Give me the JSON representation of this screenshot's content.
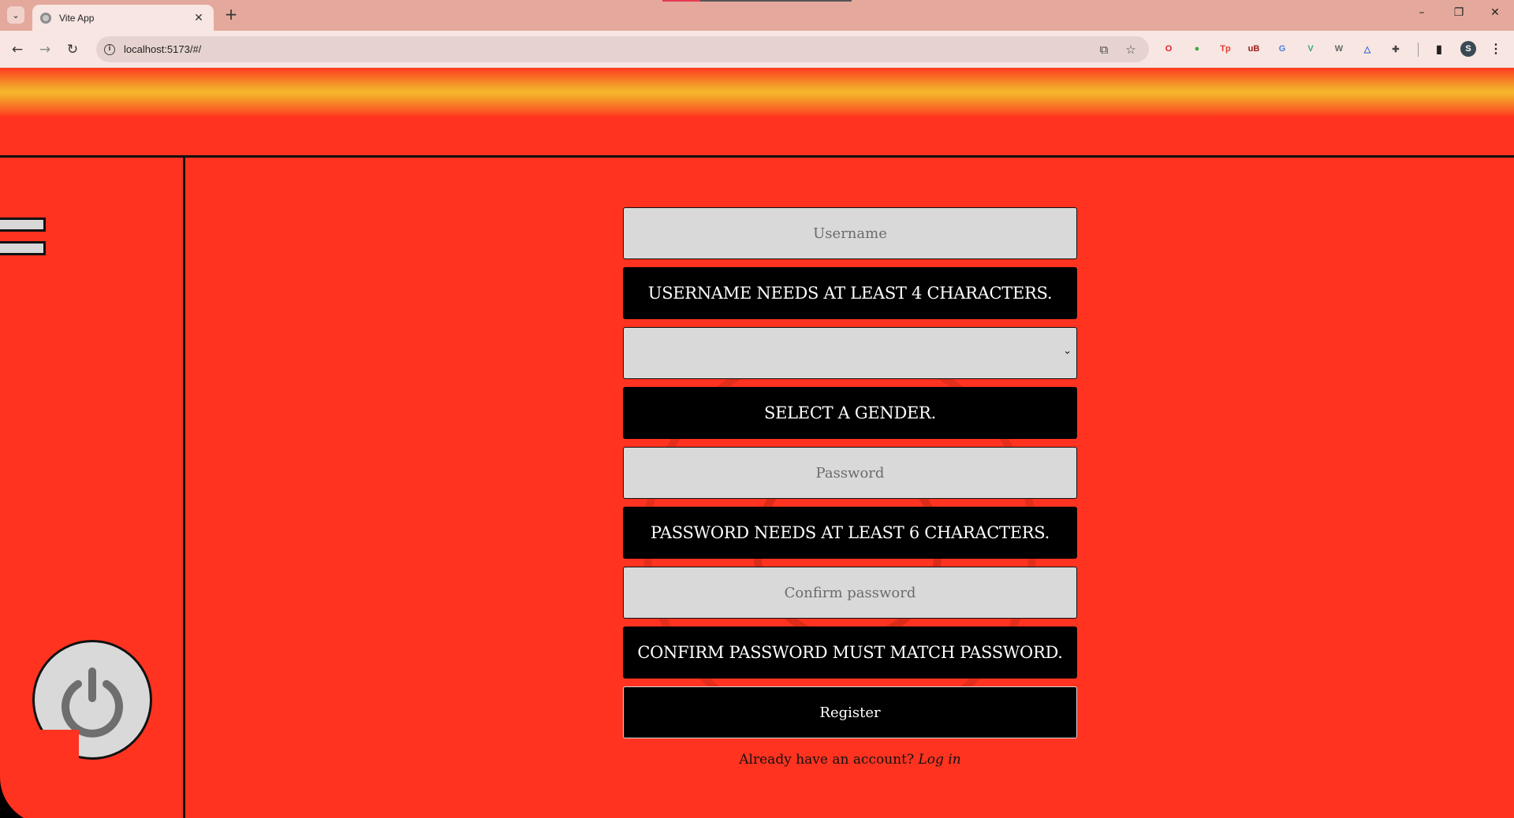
{
  "browser": {
    "tab_title": "Vite App",
    "url": "localhost:5173/#/",
    "new_tab": "+",
    "tab_close": "✕",
    "tab_search": "⌄",
    "window_controls": {
      "minimize": "–",
      "restore": "❐",
      "close": "✕"
    },
    "nav": {
      "back": "←",
      "forward": "→",
      "reload": "↻"
    },
    "omnibox_icons": {
      "translate": "⧉",
      "bookmark": "☆"
    },
    "extensions": [
      {
        "name": "opera-icon",
        "glyph": "O",
        "color": "#e0202a"
      },
      {
        "name": "colorzilla-icon",
        "glyph": "●",
        "color": "#3aa84a"
      },
      {
        "name": "tp-icon",
        "glyph": "Tp",
        "color": "#e33b2f"
      },
      {
        "name": "ublock-icon",
        "glyph": "uB",
        "color": "#9b1a1a"
      },
      {
        "name": "translate-ext-icon",
        "glyph": "G",
        "color": "#4a7fe0"
      },
      {
        "name": "vue-devtools-icon",
        "glyph": "V",
        "color": "#3aa876"
      },
      {
        "name": "wordpress-icon",
        "glyph": "W",
        "color": "#666666"
      },
      {
        "name": "drive-icon",
        "glyph": "△",
        "color": "#3b6fd6"
      },
      {
        "name": "extensions-icon",
        "glyph": "✚",
        "color": "#444444"
      }
    ],
    "sidepanel_icon": "▮",
    "profile_initial": "S",
    "menu_icon": "⋮"
  },
  "form": {
    "username_placeholder": "Username",
    "username_error": "USERNAME NEEDS AT LEAST 4 CHARACTERS.",
    "gender_value": "",
    "gender_chevron": "⌄",
    "gender_error": "SELECT A GENDER.",
    "password_placeholder": "Password",
    "password_error": "PASSWORD NEEDS AT LEAST 6 CHARACTERS.",
    "confirm_placeholder": "Confirm password",
    "confirm_error": "CONFIRM PASSWORD MUST MATCH PASSWORD.",
    "register_label": "Register",
    "login_prompt": "Already have an account?",
    "login_link": "Log in"
  },
  "colors": {
    "background": "#ff3320",
    "glow": "#f7b62c",
    "input": "#d9d9d9",
    "error_bg": "#000000"
  }
}
